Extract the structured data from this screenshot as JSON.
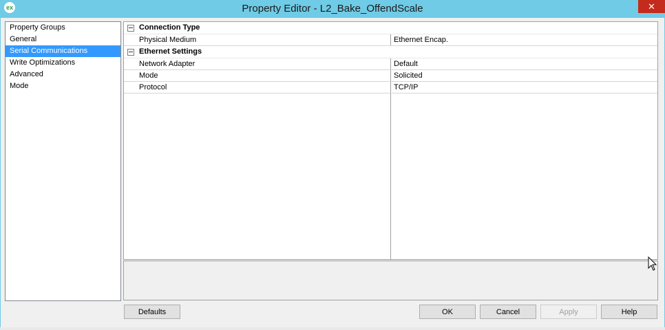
{
  "window": {
    "title": "Property Editor - L2_Bake_OffendScale",
    "icon_text": "ex",
    "close_glyph": "✕",
    "accent_color": "#6fcbe6"
  },
  "property_groups": {
    "items": [
      {
        "label": "Property Groups",
        "selected": false
      },
      {
        "label": "General",
        "selected": false
      },
      {
        "label": "Serial Communications",
        "selected": true
      },
      {
        "label": "Write Optimizations",
        "selected": false
      },
      {
        "label": "Advanced",
        "selected": false
      },
      {
        "label": "Mode",
        "selected": false
      }
    ]
  },
  "grid": {
    "categories": [
      {
        "title": "Connection Type",
        "properties": [
          {
            "name": "Physical Medium",
            "value": "Ethernet Encap."
          }
        ]
      },
      {
        "title": "Ethernet Settings",
        "properties": [
          {
            "name": "Network Adapter",
            "value": "Default"
          },
          {
            "name": "Mode",
            "value": "Solicited"
          },
          {
            "name": "Protocol",
            "value": "TCP/IP"
          }
        ]
      }
    ]
  },
  "buttons": {
    "defaults": "Defaults",
    "ok": "OK",
    "cancel": "Cancel",
    "apply": "Apply",
    "help": "Help"
  }
}
